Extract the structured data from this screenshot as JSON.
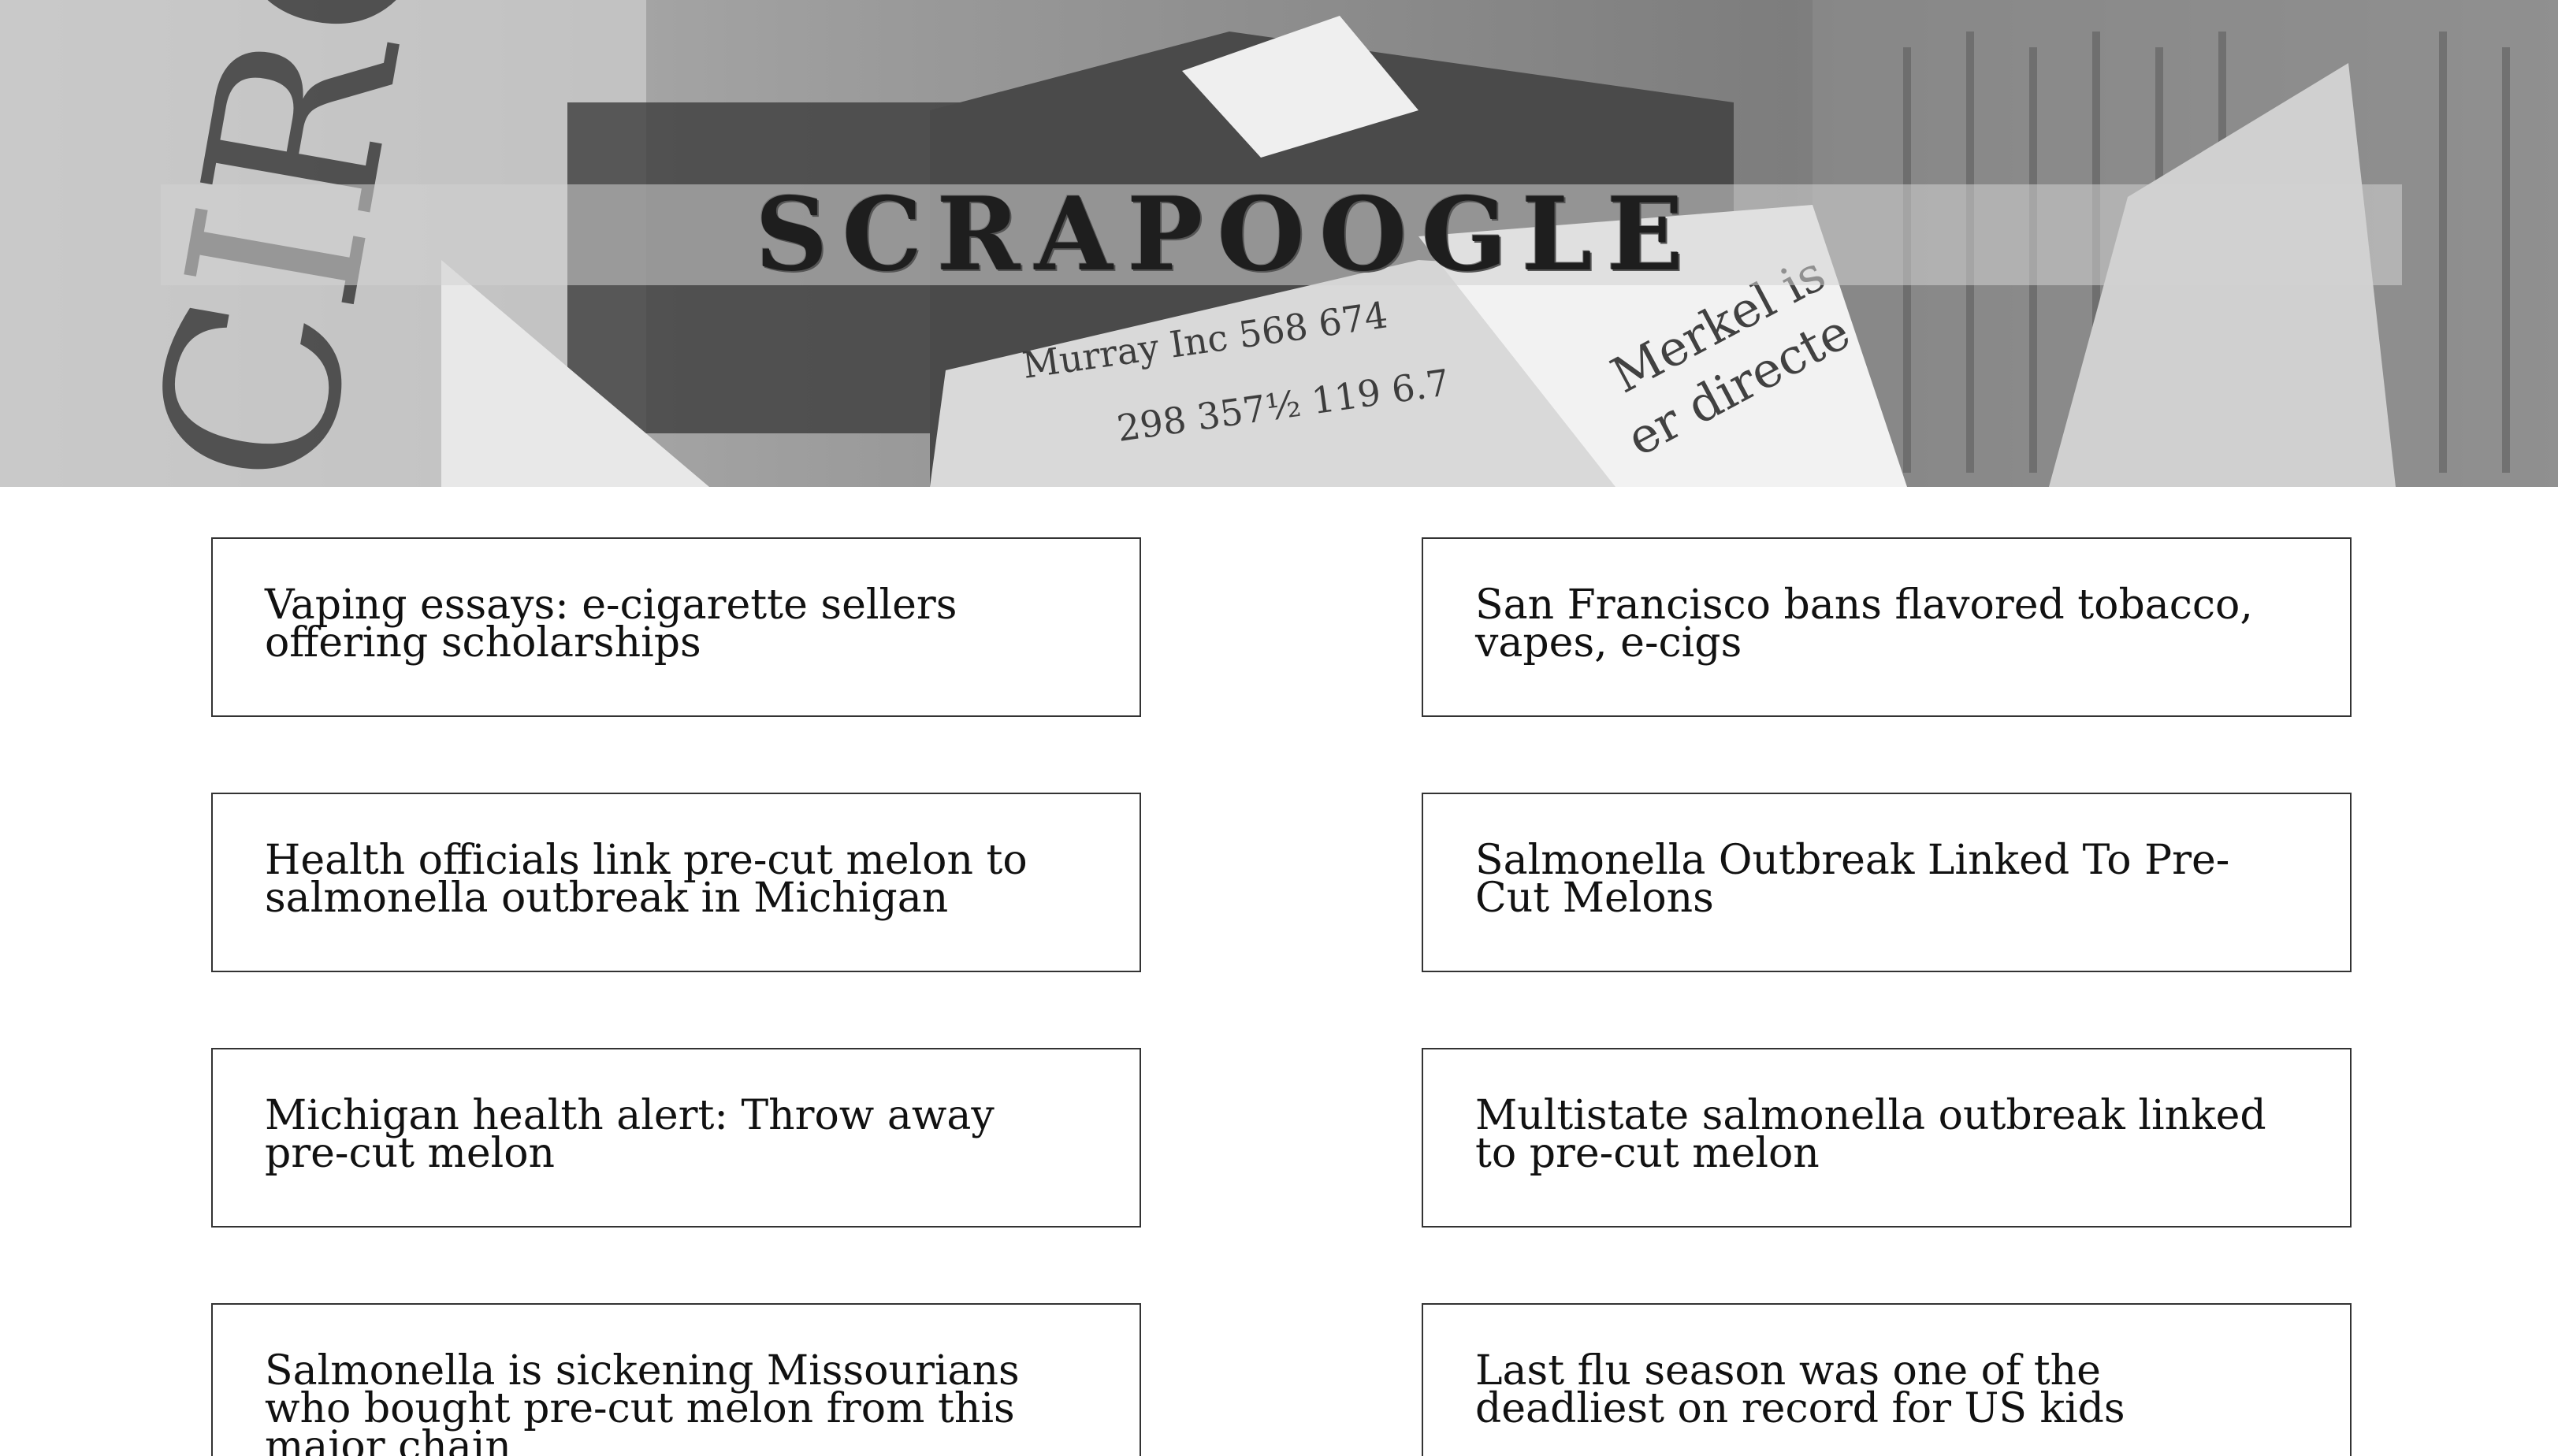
{
  "header": {
    "title": "SCRAPOOGLE",
    "background": "newspaper-origami-photo"
  },
  "articles": [
    {
      "title": "Vaping essays: e-cigarette sellers offering scholarships"
    },
    {
      "title": "San Francisco bans flavored tobacco, vapes, e-cigs"
    },
    {
      "title": "Health officials link pre-cut melon to salmonella outbreak in Michigan"
    },
    {
      "title": "Salmonella Outbreak Linked To Pre-Cut Melons"
    },
    {
      "title": "Michigan health alert: Throw away pre-cut melon"
    },
    {
      "title": "Multistate salmonella outbreak linked to pre-cut melon"
    },
    {
      "title": "Salmonella is sickening Missourians who bought pre-cut melon from this major chain"
    },
    {
      "title": "Last flu season was one of the deadliest on record for US kids"
    }
  ],
  "colors": {
    "card_border": "#333333",
    "text": "#111111",
    "background": "#ffffff"
  }
}
